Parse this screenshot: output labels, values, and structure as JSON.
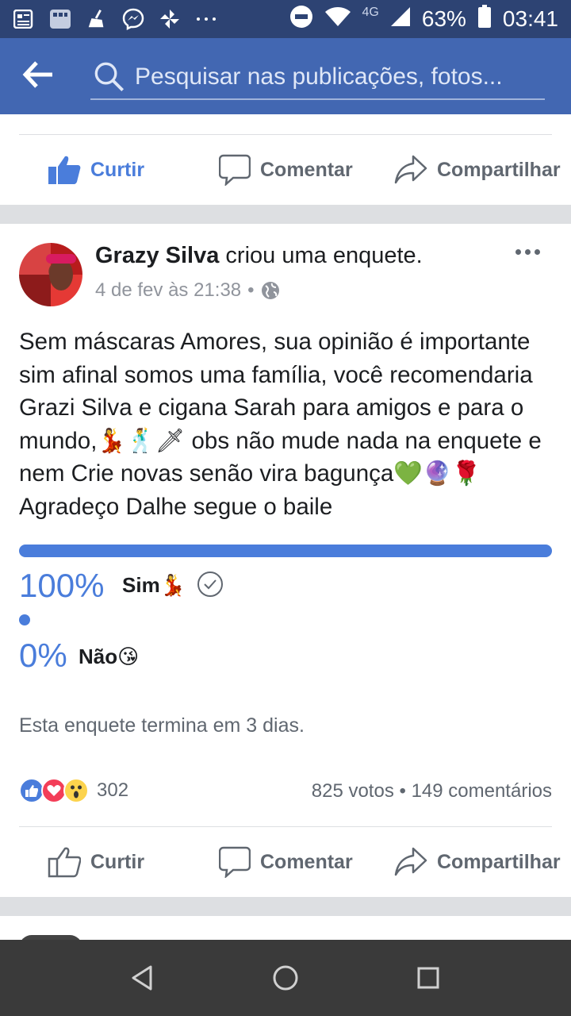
{
  "status_bar": {
    "icons": [
      "news-icon",
      "gallery-icon",
      "cleaner-icon",
      "messenger-icon",
      "pinwheel-icon",
      "more-dots-icon",
      "dnd-icon",
      "wifi-icon"
    ],
    "network": "4G",
    "battery": "63%",
    "time": "03:41"
  },
  "search": {
    "placeholder": "Pesquisar nas publicações, fotos..."
  },
  "top_actions": {
    "like": "Curtir",
    "comment": "Comentar",
    "share": "Compartilhar",
    "like_active": true
  },
  "post": {
    "author": "Grazy Silva",
    "action": " criou uma enquete.",
    "date": "4 de fev às 21:38",
    "separator": "•",
    "text": "Sem máscaras Amores, sua opinião é importante sim afinal somos uma família, você recomendaria Grazi Silva e cigana Sarah para amigos e para o mundo,💃🕺🗡 obs não mude nada na enquete e nem Crie novas senão vira bagunça💚🔮🌹 Agradeço Dalhe segue o baile",
    "poll": {
      "options": [
        {
          "percent": "100%",
          "label": "Sim💃",
          "fraction": 1.0,
          "selected": true
        },
        {
          "percent": "0%",
          "label": "Não😘",
          "fraction": 0.0,
          "selected": false
        }
      ],
      "ends": "Esta enquete termina em 3 dias."
    },
    "reactions": {
      "types": [
        "like",
        "love",
        "wow"
      ],
      "count": "302"
    },
    "stats": "825 votos • 149 comentários",
    "actions": {
      "like": "Curtir",
      "comment": "Comentar",
      "share": "Compartilhar"
    }
  },
  "colors": {
    "status_bar": "#2d4373",
    "app_bar": "#4267b2",
    "accent": "#4a7ddb",
    "separator": "#dddfe2",
    "nav_bar": "#3a3a3a"
  }
}
